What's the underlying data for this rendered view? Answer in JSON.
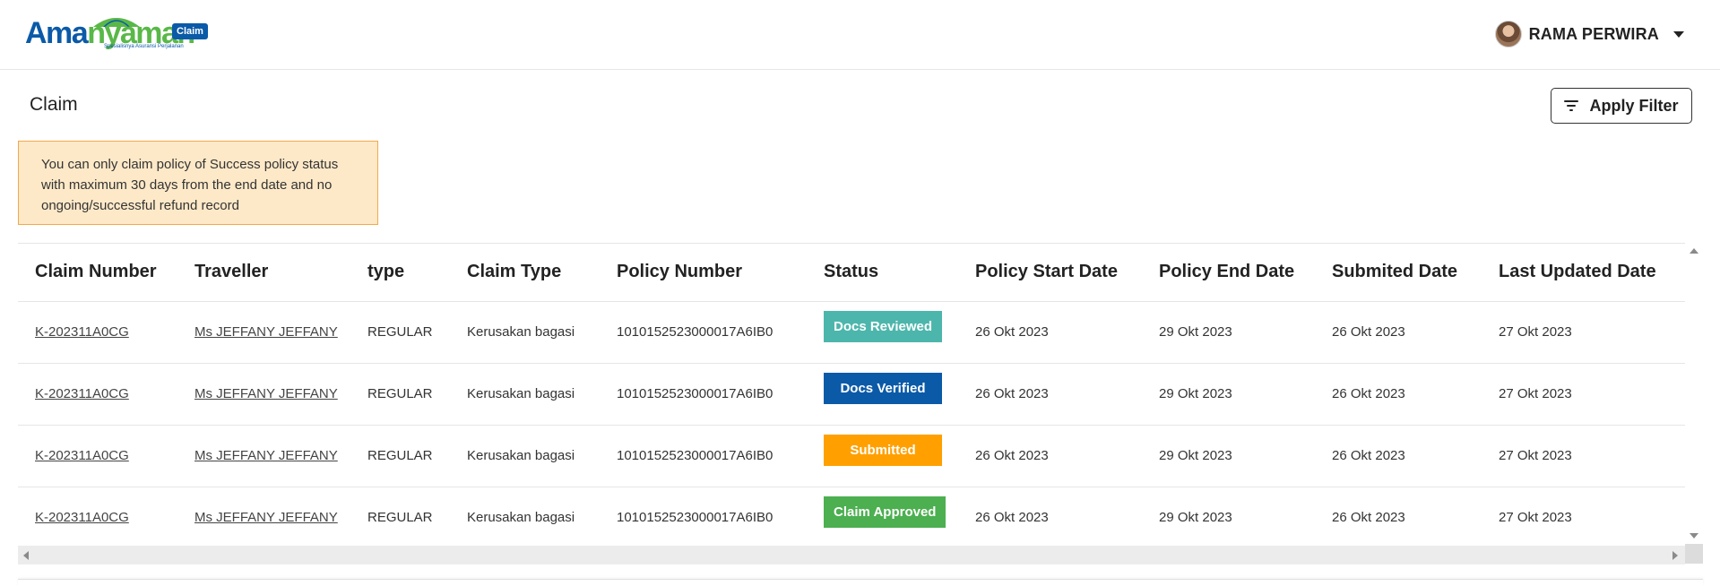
{
  "header": {
    "logo": {
      "part1": "Ama",
      "part2": "nyaman",
      "badge": "Claim",
      "tagline": "Spesialisnya Asuransi Perjalanan"
    },
    "user": {
      "name": "RAMA PERWIRA"
    }
  },
  "page": {
    "title": "Claim",
    "filter_button": "Apply Filter",
    "notice": "You can only claim policy of Success policy status with maximum 30 days from the end date and no ongoing/successful refund record"
  },
  "colors": {
    "brand_blue": "#0b5aa8",
    "brand_green": "#59b848",
    "notice_bg": "#fde9c8",
    "notice_border": "#f3a94a"
  },
  "table": {
    "columns": [
      "Claim Number",
      "Traveller",
      "type",
      "Claim Type",
      "Policy Number",
      "Status",
      "Policy Start Date",
      "Policy End Date",
      "Submited Date",
      "Last Updated Date"
    ],
    "rows": [
      {
        "claim_number": "K-202311A0CG",
        "traveller": "Ms JEFFANY JEFFANY",
        "type": "REGULAR",
        "claim_type": "Kerusakan bagasi",
        "policy_number": "1010152523000017A6IB0",
        "status": "Docs Reviewed",
        "status_color": "#4db6ac",
        "start": "26 Okt 2023",
        "end": "29 Okt 2023",
        "submitted": "26 Okt 2023",
        "updated": "27 Okt 2023"
      },
      {
        "claim_number": "K-202311A0CG",
        "traveller": "Ms JEFFANY JEFFANY",
        "type": "REGULAR",
        "claim_type": "Kerusakan bagasi",
        "policy_number": "1010152523000017A6IB0",
        "status": "Docs Verified",
        "status_color": "#0b5aa8",
        "start": "26 Okt 2023",
        "end": "29 Okt 2023",
        "submitted": "26 Okt 2023",
        "updated": "27 Okt 2023"
      },
      {
        "claim_number": "K-202311A0CG",
        "traveller": "Ms JEFFANY JEFFANY",
        "type": "REGULAR",
        "claim_type": "Kerusakan bagasi",
        "policy_number": "1010152523000017A6IB0",
        "status": "Submitted",
        "status_color": "#ffa000",
        "start": "26 Okt 2023",
        "end": "29 Okt 2023",
        "submitted": "26 Okt 2023",
        "updated": "27 Okt 2023"
      },
      {
        "claim_number": "K-202311A0CG",
        "traveller": "Ms JEFFANY JEFFANY",
        "type": "REGULAR",
        "claim_type": "Kerusakan bagasi",
        "policy_number": "1010152523000017A6IB0",
        "status": "Claim Approved",
        "status_color": "#4caf50",
        "start": "26 Okt 2023",
        "end": "29 Okt 2023",
        "submitted": "26 Okt 2023",
        "updated": "27 Okt 2023"
      }
    ]
  }
}
